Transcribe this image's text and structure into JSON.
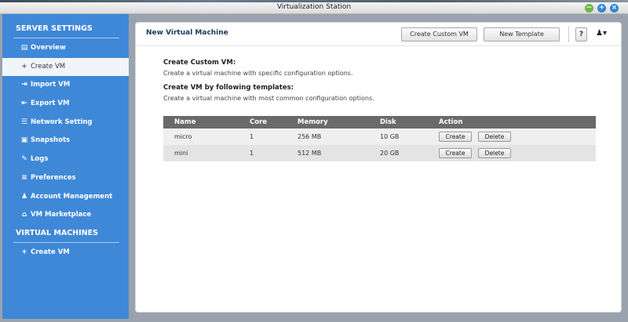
{
  "window": {
    "title": "Virtualization Station"
  },
  "sidebar": {
    "server_settings_title": "SERVER SETTINGS",
    "items": [
      {
        "label": "Overview",
        "icon": "overview-icon"
      },
      {
        "label": "Create VM",
        "icon": "plus-icon"
      },
      {
        "label": "Import VM",
        "icon": "import-icon"
      },
      {
        "label": "Export VM",
        "icon": "export-icon"
      },
      {
        "label": "Network Setting",
        "icon": "network-icon"
      },
      {
        "label": "Snapshots",
        "icon": "camera-icon"
      },
      {
        "label": "Logs",
        "icon": "logs-icon"
      },
      {
        "label": "Preferences",
        "icon": "preferences-icon"
      },
      {
        "label": "Account Management",
        "icon": "account-icon"
      },
      {
        "label": "VM Marketplace",
        "icon": "marketplace-icon"
      }
    ],
    "virtual_machines_title": "VIRTUAL MACHINES",
    "vm_items": [
      {
        "label": "Create VM",
        "icon": "plus-icon"
      }
    ]
  },
  "main": {
    "title": "New Virtual Machine",
    "buttons": {
      "create_custom": "Create Custom VM",
      "new_template": "New Template",
      "help": "?"
    },
    "custom_heading": "Create Custom VM:",
    "custom_desc": "Create a virtual machine with specific configuration options.",
    "templates_heading": "Create VM by following templates:",
    "templates_desc": "Create a virtual machine with most common configuration options.",
    "table": {
      "headers": [
        "Name",
        "Core",
        "Memory",
        "Disk",
        "Action"
      ],
      "rows": [
        {
          "name": "micro",
          "core": "1",
          "memory": "256 MB",
          "disk": "10 GB"
        },
        {
          "name": "mini",
          "core": "1",
          "memory": "512 MB",
          "disk": "20 GB"
        }
      ],
      "action_create": "Create",
      "action_delete": "Delete"
    }
  }
}
